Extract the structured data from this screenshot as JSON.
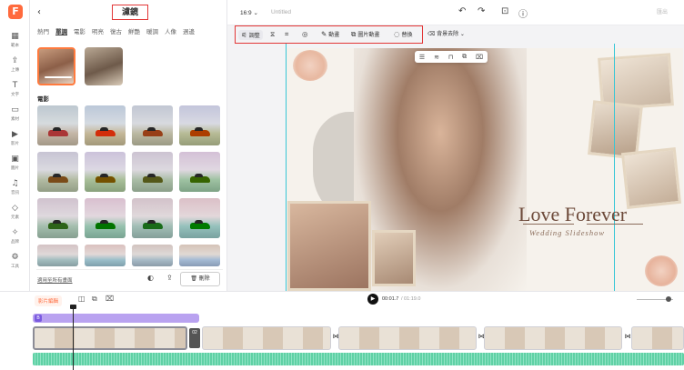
{
  "rail": {
    "items": [
      {
        "icon": "template-icon",
        "glyph": "▦",
        "label": "範本"
      },
      {
        "icon": "upload-icon",
        "glyph": "⇪",
        "label": "上傳"
      },
      {
        "icon": "text-icon",
        "glyph": "T",
        "label": "文字"
      },
      {
        "icon": "media-icon",
        "glyph": "▭",
        "label": "素材"
      },
      {
        "icon": "video-icon",
        "glyph": "▶",
        "label": "影片"
      },
      {
        "icon": "image-icon",
        "glyph": "▣",
        "label": "圖片"
      },
      {
        "icon": "music-icon",
        "glyph": "♫",
        "label": "音訊"
      },
      {
        "icon": "element-icon",
        "glyph": "◇",
        "label": "元素"
      },
      {
        "icon": "brand-icon",
        "glyph": "✧",
        "label": "品牌"
      },
      {
        "icon": "tools-icon",
        "glyph": "⚙",
        "label": "工具"
      }
    ]
  },
  "panel": {
    "title": "濾鏡",
    "tabs": [
      "熱門",
      "單調",
      "電影",
      "明亮",
      "復古",
      "鮮艷",
      "暖調",
      "人像",
      "週邊"
    ],
    "active_tab_index": 1,
    "group_label": "電影",
    "footer_link": "適用至所有畫面",
    "delete_label": "刪除"
  },
  "topbar": {
    "ratio": "16:9 ⌄",
    "title": "Untitled",
    "export_label": "匯出"
  },
  "toolbar": {
    "items": [
      {
        "icon": "adjust-icon",
        "glyph": "⚟",
        "label": "調整"
      },
      {
        "icon": "flip-icon",
        "glyph": "⧖",
        "label": ""
      },
      {
        "icon": "crop-icon",
        "glyph": "⌗",
        "label": ""
      },
      {
        "icon": "mask-icon",
        "glyph": "◎",
        "label": ""
      },
      {
        "icon": "animation-icon",
        "glyph": "✎",
        "label": "動畫"
      },
      {
        "icon": "in-animation-icon",
        "glyph": "⧉",
        "label": "圖片動畫"
      },
      {
        "icon": "replace-icon",
        "glyph": "◌",
        "label": "替換"
      }
    ],
    "bg_remove_label": "背景去除 ⌄"
  },
  "canvas": {
    "title_text": "Love Forever",
    "subtitle_text": "Wedding Slideshow"
  },
  "timeline": {
    "mode_chip": "影片編輯",
    "current_time": "00:01.7",
    "total_time": "/ 01:19.0",
    "badge": "02",
    "track_icon": "B"
  },
  "colors": {
    "accent": "#ff6a3d",
    "highlight_box": "#e23636",
    "guide": "#36c6d6",
    "audio": "#5fd1a5",
    "overlay_track": "#b9a2f0"
  }
}
